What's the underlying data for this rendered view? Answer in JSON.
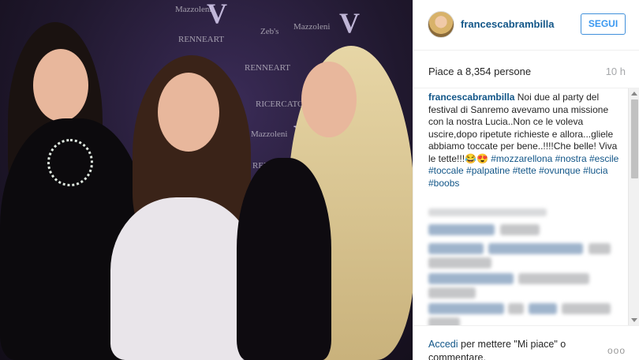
{
  "post": {
    "username": "francescabrambilla",
    "follow_label": "SEGUI",
    "likes_text": "Piace a 8,354 persone",
    "time_ago": "10 h",
    "caption_user": "francescabrambilla",
    "caption_text": " Noi due al party del festival di Sanremo avevamo una missione con la nostra Lucia..Non ce le voleva uscire,dopo ripetute richieste e allora...gliele abbiamo toccate per bene..!!!!Che belle! Viva le tette!!!😂😍 ",
    "caption_tags": "#mozzarellona #nostra #escile #toccale #palpatine #tette #ovunque #lucia #boobs"
  },
  "photo": {
    "backdrop_logos": [
      "Mazzoleni",
      "RENNEART",
      "Zeb's",
      "Mazzoleni",
      "RENNEART",
      "RICERCATO",
      "Mazzoleni",
      "RENNEART"
    ],
    "backdrop_letter": "V"
  },
  "footer": {
    "login_link": "Accedi",
    "login_text": " per mettere \"Mi piace\" o commentare.",
    "more_label": "ooo"
  },
  "colors": {
    "link_blue": "#125688",
    "follow_blue": "#3897f0"
  }
}
